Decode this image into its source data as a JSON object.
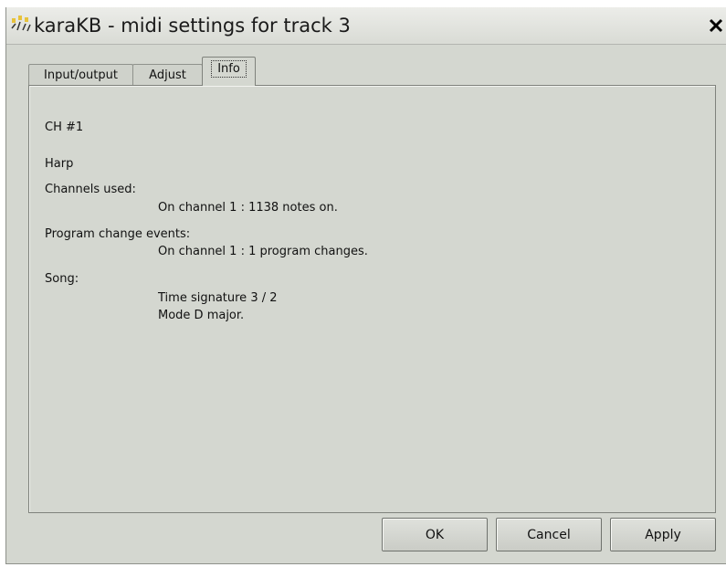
{
  "window": {
    "title": "karaKB - midi settings for track 3"
  },
  "tabs": [
    {
      "label": "Input/output"
    },
    {
      "label": "Adjust"
    },
    {
      "label": "Info"
    }
  ],
  "info": {
    "channel": "CH #1",
    "instrument": "Harp",
    "channels_used_label": "Channels used:",
    "channels_used_value": "On channel 1 : 1138 notes on.",
    "program_change_label": "Program change events:",
    "program_change_value": "On channel 1 : 1 program changes.",
    "song_label": "Song:",
    "time_signature": "Time signature 3 / 2",
    "mode": "Mode D major."
  },
  "buttons": {
    "ok": "OK",
    "cancel": "Cancel",
    "apply": "Apply"
  },
  "icons": {
    "app": "karakb-app-icon",
    "close": "close-icon"
  }
}
